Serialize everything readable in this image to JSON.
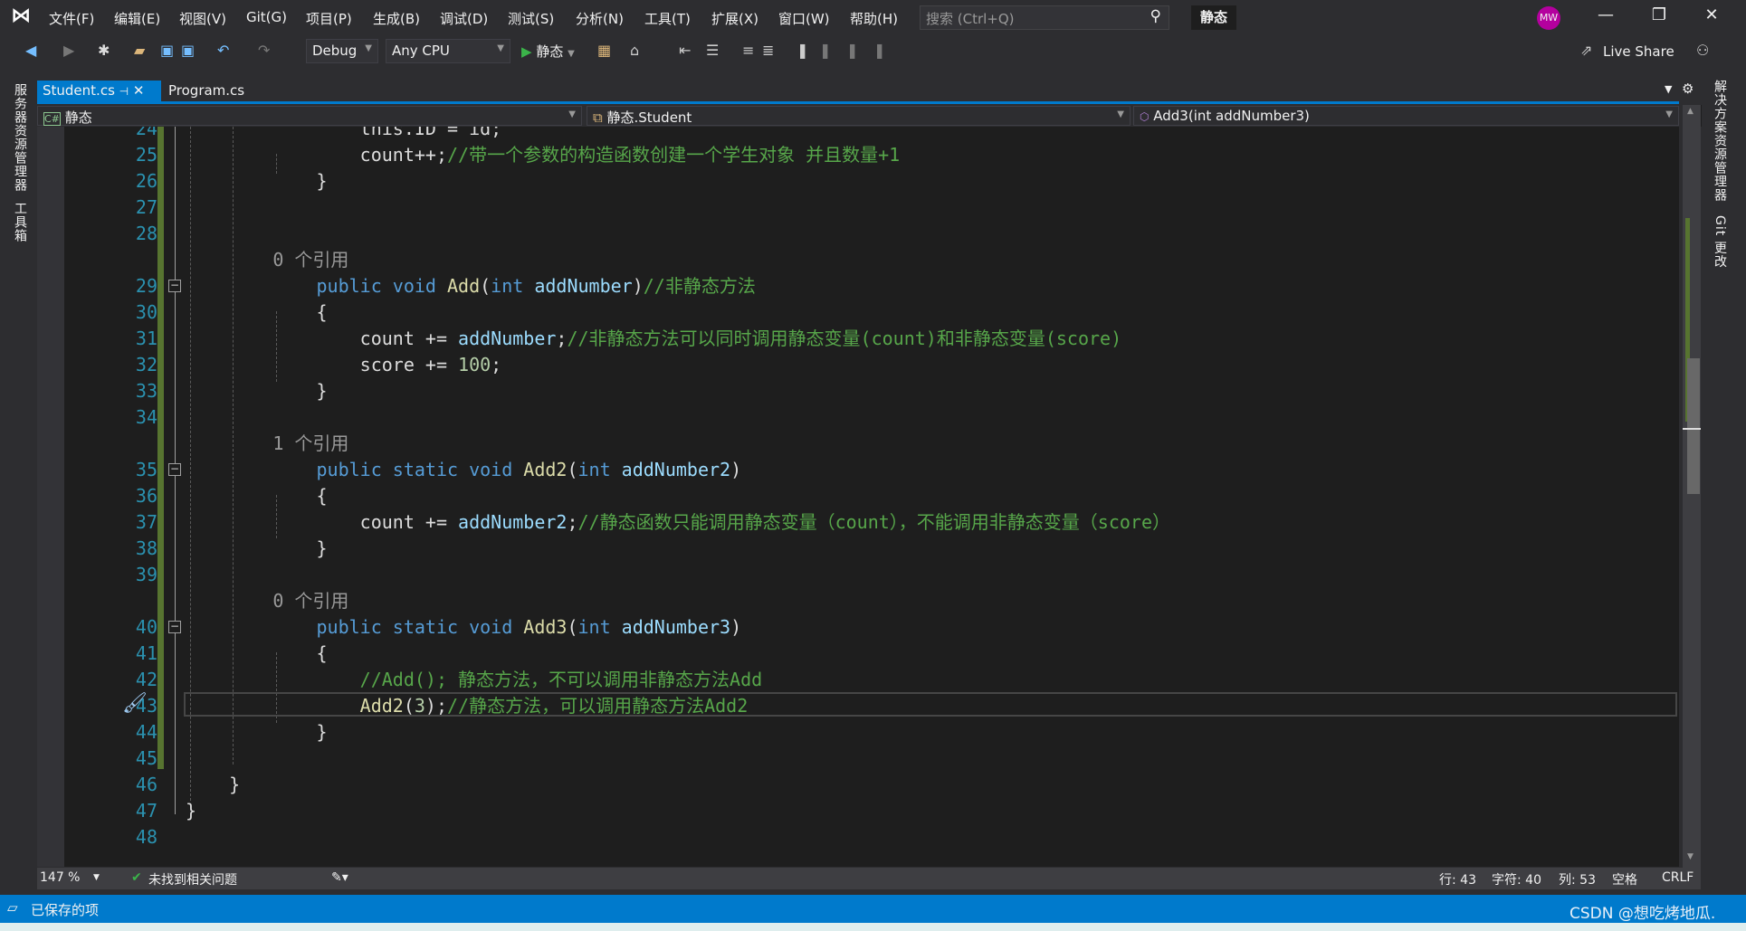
{
  "colors": {
    "accent": "#007acc",
    "background": "#1e1e1e",
    "keyword": "#569cd6",
    "method": "#dcdcaa",
    "parameter": "#9cdcfe",
    "comment": "#57a64a",
    "line_number": "#2b91af",
    "avatar": "#b4009e",
    "change_bar": "#577430"
  },
  "menu": [
    "文件(F)",
    "编辑(E)",
    "视图(V)",
    "Git(G)",
    "项目(P)",
    "生成(B)",
    "调试(D)",
    "测试(S)",
    "分析(N)",
    "工具(T)",
    "扩展(X)",
    "窗口(W)",
    "帮助(H)"
  ],
  "search": {
    "placeholder": "搜索 (Ctrl+Q)"
  },
  "solution_name": "静态",
  "avatar": "MW",
  "toolbar": {
    "config": "Debug",
    "platform": "Any CPU",
    "run_label": "静态",
    "live_share": "Live Share"
  },
  "tabs": [
    {
      "label": "Student.cs",
      "active": true
    },
    {
      "label": "Program.cs",
      "active": false
    }
  ],
  "navbar": {
    "project": "静态",
    "class": "静态.Student",
    "member": "Add3(int addNumber3)"
  },
  "left_panels": [
    "服务器资源管理器",
    "工具箱"
  ],
  "right_panels": [
    "解决方案资源管理器",
    "Git 更改"
  ],
  "code": [
    {
      "n": "24",
      "t": [
        [
          "tx",
          "        this.ID = id;"
        ]
      ]
    },
    {
      "n": "25",
      "t": [
        [
          "tx",
          "        count++;"
        ],
        [
          "cm",
          "//带一个参数的构造函数创建一个学生对象 并且数量+1"
        ]
      ]
    },
    {
      "n": "26",
      "t": [
        [
          "tx",
          "    }"
        ]
      ]
    },
    {
      "n": "27",
      "t": []
    },
    {
      "n": "28",
      "t": []
    },
    {
      "lens": "0 个引用"
    },
    {
      "n": "29",
      "fold": true,
      "t": [
        [
          "kw",
          "    public void "
        ],
        [
          "fn",
          "Add"
        ],
        [
          "tx",
          "("
        ],
        [
          "kw",
          "int "
        ],
        [
          "pm",
          "addNumber"
        ],
        [
          "tx",
          ")"
        ],
        [
          "cm",
          "//非静态方法"
        ]
      ]
    },
    {
      "n": "30",
      "t": [
        [
          "tx",
          "    {"
        ]
      ]
    },
    {
      "n": "31",
      "t": [
        [
          "tx",
          "        count += "
        ],
        [
          "pm",
          "addNumber"
        ],
        [
          "tx",
          ";"
        ],
        [
          "cm",
          "//非静态方法可以同时调用静态变量(count)和非静态变量(score)"
        ]
      ]
    },
    {
      "n": "32",
      "t": [
        [
          "tx",
          "        score += "
        ],
        [
          "nm",
          "100"
        ],
        [
          "tx",
          ";"
        ]
      ]
    },
    {
      "n": "33",
      "t": [
        [
          "tx",
          "    }"
        ]
      ]
    },
    {
      "n": "34",
      "t": []
    },
    {
      "lens": "1 个引用"
    },
    {
      "n": "35",
      "fold": true,
      "t": [
        [
          "kw",
          "    public static void "
        ],
        [
          "fn",
          "Add2"
        ],
        [
          "tx",
          "("
        ],
        [
          "kw",
          "int "
        ],
        [
          "pm",
          "addNumber2"
        ],
        [
          "tx",
          ")"
        ]
      ]
    },
    {
      "n": "36",
      "t": [
        [
          "tx",
          "    {"
        ]
      ]
    },
    {
      "n": "37",
      "t": [
        [
          "tx",
          "        count += "
        ],
        [
          "pm",
          "addNumber2"
        ],
        [
          "tx",
          ";"
        ],
        [
          "cm",
          "//静态函数只能调用静态变量（count），不能调用非静态变量（score）"
        ]
      ]
    },
    {
      "n": "38",
      "t": [
        [
          "tx",
          "    }"
        ]
      ]
    },
    {
      "n": "39",
      "t": []
    },
    {
      "lens": "0 个引用"
    },
    {
      "n": "40",
      "fold": true,
      "t": [
        [
          "kw",
          "    public static void "
        ],
        [
          "fn",
          "Add3"
        ],
        [
          "tx",
          "("
        ],
        [
          "kw",
          "int "
        ],
        [
          "pm",
          "addNumber3"
        ],
        [
          "tx",
          ")"
        ]
      ]
    },
    {
      "n": "41",
      "t": [
        [
          "tx",
          "    {"
        ]
      ]
    },
    {
      "n": "42",
      "t": [
        [
          "cm",
          "        //Add(); 静态方法，不可以调用非静态方法Add"
        ]
      ]
    },
    {
      "n": "43",
      "t": [
        [
          "fn",
          "        Add2"
        ],
        [
          "tx",
          "("
        ],
        [
          "nm",
          "3"
        ],
        [
          "tx",
          ");"
        ],
        [
          "cm",
          "//静态方法，可以调用静态方法Add2"
        ]
      ]
    },
    {
      "n": "44",
      "t": [
        [
          "tx",
          "    }"
        ]
      ]
    },
    {
      "n": "45",
      "t": []
    },
    {
      "n": "46",
      "t": [
        [
          "tx",
          "}"
        ]
      ],
      "indent": 1
    },
    {
      "n": "47",
      "t": [
        [
          "tx",
          "}"
        ]
      ],
      "indent": 0
    },
    {
      "n": "48",
      "t": []
    }
  ],
  "editor_status": {
    "zoom": "147 %",
    "issues": "未找到相关问题",
    "line": "行: 43",
    "char": "字符: 40",
    "col": "列: 53",
    "whitespace": "空格",
    "eol": "CRLF"
  },
  "statusbar": {
    "message": "已保存的项",
    "watermark": "CSDN @想吃烤地瓜."
  }
}
